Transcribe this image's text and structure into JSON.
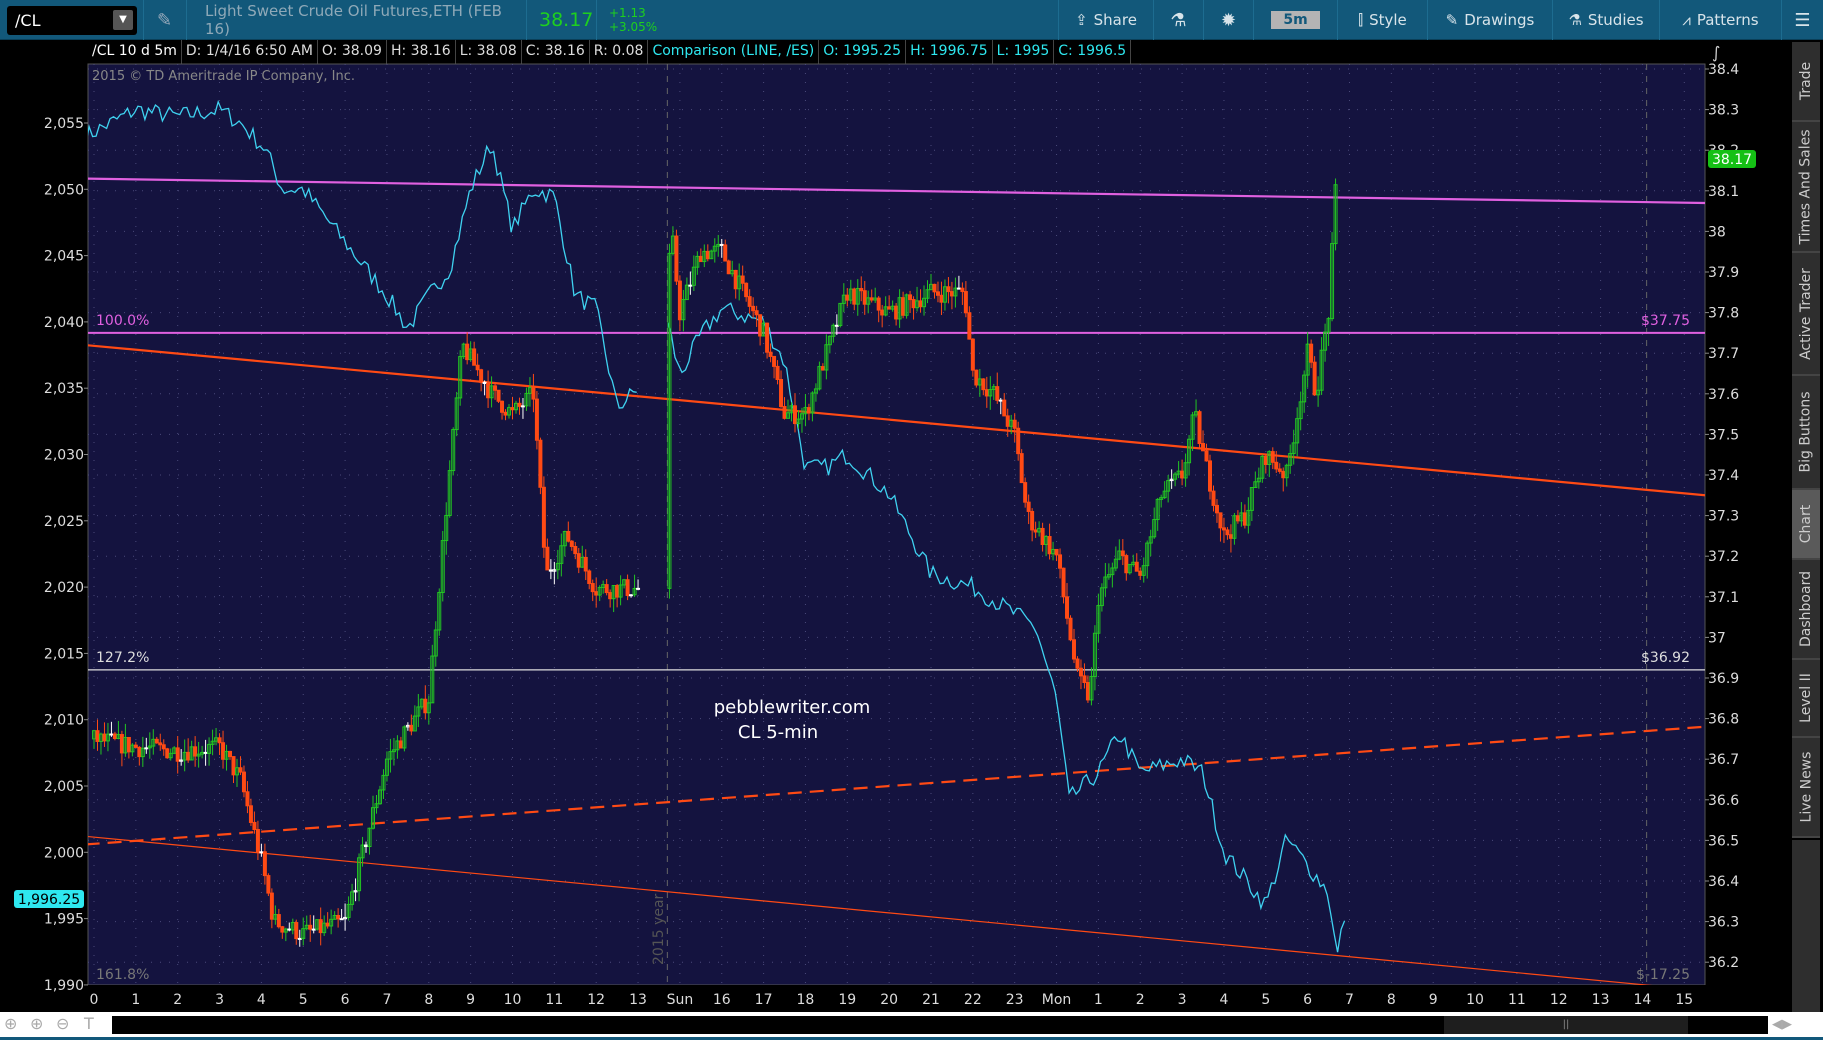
{
  "toolbar": {
    "symbol": "/CL",
    "description": "Light Sweet Crude Oil Futures,ETH (FEB 16)",
    "last": "38.17",
    "change": "+1.13",
    "change_pct": "+3.05%",
    "share": "Share",
    "timeframe": "5m",
    "style": "Style",
    "drawings": "Drawings",
    "studies": "Studies",
    "patterns": "Patterns"
  },
  "infobar": {
    "title": "/CL 10 d 5m",
    "date": "D: 1/4/16 6:50 AM",
    "open": "O: 38.09",
    "high": "H: 38.16",
    "low": "L: 38.08",
    "close": "C: 38.16",
    "range": "R: 0.08",
    "comparison": "Comparison (LINE, /ES)",
    "cmp_open": "O: 1995.25",
    "cmp_high": "H: 1996.75",
    "cmp_low": "L: 1995",
    "cmp_close": "C: 1996.5"
  },
  "copyright": "2015 © TD Ameritrade IP Company, Inc.",
  "watermark": {
    "line1": "pebblewriter.com",
    "line2": "CL 5-min"
  },
  "year_marker": "2015 year",
  "markers": {
    "left": "1,996.25",
    "right": "38.17"
  },
  "sidebar": [
    "Trade",
    "Times And Sales",
    "Active Trader",
    "Big Buttons",
    "Chart",
    "Dashboard",
    "Level II",
    "Live News"
  ],
  "sidebar_active": "Chart",
  "colors": {
    "up": "#22c422",
    "down": "#ff4a14",
    "compare": "#3fd2f0",
    "magenta": "#e060e0",
    "orange": "#ff4a14",
    "plot_bg": "#14133f"
  },
  "chart_data": {
    "type": "candlestick",
    "x_ticks": [
      "0",
      "1",
      "2",
      "3",
      "4",
      "5",
      "6",
      "7",
      "8",
      "9",
      "10",
      "11",
      "12",
      "13",
      "Sun",
      "16",
      "17",
      "18",
      "19",
      "20",
      "21",
      "22",
      "23",
      "Mon",
      "1",
      "2",
      "3",
      "4",
      "5",
      "6",
      "7",
      "8",
      "9",
      "10",
      "11",
      "12",
      "13",
      "14",
      "15"
    ],
    "right_axis": {
      "min": 36.2,
      "max": 38.4,
      "step": 0.1,
      "labels": [
        "38.4",
        "38.3",
        "38.2",
        "38.1",
        "38",
        "37.9",
        "37.8",
        "37.7",
        "37.6",
        "37.5",
        "37.4",
        "37.3",
        "37.2",
        "37.1",
        "37",
        "36.9",
        "36.8",
        "36.7",
        "36.6",
        "36.5",
        "36.4",
        "36.3",
        "36.2"
      ]
    },
    "left_axis": {
      "min": 1990,
      "max": 2055,
      "labels": [
        "2,055",
        "2,050",
        "2,045",
        "2,040",
        "2,035",
        "2,030",
        "2,025",
        "2,020",
        "2,015",
        "2,010",
        "2,005",
        "2,000",
        "1,995",
        "1,990"
      ]
    },
    "cl_path": [
      [
        0,
        36.75
      ],
      [
        1,
        36.73
      ],
      [
        2,
        36.72
      ],
      [
        3,
        36.73
      ],
      [
        3.5,
        36.65
      ],
      [
        4,
        36.45
      ],
      [
        4.3,
        36.3
      ],
      [
        5,
        36.27
      ],
      [
        6,
        36.3
      ],
      [
        6.5,
        36.5
      ],
      [
        7,
        36.7
      ],
      [
        8,
        36.85
      ],
      [
        8.4,
        37.3
      ],
      [
        8.8,
        37.72
      ],
      [
        9.5,
        37.6
      ],
      [
        10,
        37.55
      ],
      [
        10.5,
        37.6
      ],
      [
        10.8,
        37.15
      ],
      [
        11.3,
        37.25
      ],
      [
        12,
        37.12
      ],
      [
        13,
        37.12
      ],
      [
        13.7,
        37.85
      ],
      [
        13.8,
        38.0
      ],
      [
        14,
        37.8
      ],
      [
        14.5,
        37.95
      ],
      [
        15,
        37.95
      ],
      [
        15.5,
        37.85
      ],
      [
        16,
        37.75
      ],
      [
        16.5,
        37.55
      ],
      [
        17,
        37.55
      ],
      [
        17.5,
        37.7
      ],
      [
        18,
        37.85
      ],
      [
        19,
        37.8
      ],
      [
        20,
        37.85
      ],
      [
        20.8,
        37.85
      ],
      [
        21,
        37.65
      ],
      [
        21.5,
        37.6
      ],
      [
        22,
        37.5
      ],
      [
        22.3,
        37.3
      ],
      [
        23,
        37.2
      ],
      [
        23.5,
        36.9
      ],
      [
        23.8,
        36.85
      ],
      [
        24,
        37.1
      ],
      [
        24.5,
        37.2
      ],
      [
        25,
        37.15
      ],
      [
        25.5,
        37.35
      ],
      [
        26,
        37.4
      ],
      [
        26.3,
        37.55
      ],
      [
        26.5,
        37.45
      ],
      [
        27,
        37.25
      ],
      [
        27.5,
        37.3
      ],
      [
        28,
        37.45
      ],
      [
        28.5,
        37.4
      ],
      [
        29,
        37.7
      ],
      [
        29.2,
        37.6
      ],
      [
        29.5,
        37.8
      ],
      [
        29.7,
        38.15
      ]
    ],
    "es_path": [
      [
        -0.2,
        2054
      ],
      [
        1,
        2056
      ],
      [
        2,
        2055.5
      ],
      [
        3,
        2056
      ],
      [
        3.5,
        2055
      ],
      [
        4.1,
        2053
      ],
      [
        4.5,
        2050
      ],
      [
        5,
        2050
      ],
      [
        6,
        2046
      ],
      [
        7,
        2042
      ],
      [
        7.5,
        2039.5
      ],
      [
        8,
        2042
      ],
      [
        8.5,
        2044
      ],
      [
        9,
        2050
      ],
      [
        9.5,
        2053.5
      ],
      [
        10,
        2047
      ],
      [
        10.5,
        2050
      ],
      [
        11,
        2049.5
      ],
      [
        11.5,
        2042
      ],
      [
        12,
        2041
      ],
      [
        12.5,
        2033.5
      ],
      [
        13,
        2035
      ],
      [
        13.7,
        2040
      ],
      [
        14,
        2036
      ],
      [
        14.5,
        2039
      ],
      [
        15,
        2041
      ],
      [
        16,
        2040
      ],
      [
        16.5,
        2037
      ],
      [
        17,
        2029
      ],
      [
        17.5,
        2029
      ],
      [
        18,
        2030
      ],
      [
        19,
        2027
      ],
      [
        19.5,
        2024
      ],
      [
        20,
        2021
      ],
      [
        21,
        2020
      ],
      [
        22,
        2018
      ],
      [
        22.5,
        2017
      ],
      [
        23,
        2011.5
      ],
      [
        23.3,
        2004
      ],
      [
        24,
        2006
      ],
      [
        24.5,
        2009
      ],
      [
        25,
        2006
      ],
      [
        26,
        2007
      ],
      [
        26.5,
        2006
      ],
      [
        27,
        2000
      ],
      [
        27.5,
        1998
      ],
      [
        28,
        1996
      ],
      [
        28.5,
        2001
      ],
      [
        29,
        1999
      ],
      [
        29.5,
        1997
      ],
      [
        29.7,
        1992
      ],
      [
        29.9,
        1995.5
      ]
    ],
    "es_gap": [
      13.0,
      13.7
    ],
    "drawings": [
      {
        "name": "magenta-trendline",
        "from": [
          -0.2,
          38.13
        ],
        "to": [
          38.5,
          38.07
        ],
        "color": "#e060e0",
        "dash": false
      },
      {
        "name": "orange-trendline-upper",
        "from": [
          -0.2,
          37.72
        ],
        "to": [
          38.5,
          37.35
        ],
        "color": "#ff4a14",
        "dash": false
      },
      {
        "name": "orange-dashed-trendline",
        "from": [
          -0.2,
          36.49
        ],
        "to": [
          38.5,
          36.78
        ],
        "color": "#ff4a14",
        "dash": true
      },
      {
        "name": "orange-trendline-lower",
        "from": [
          -0.2,
          36.51
        ],
        "to": [
          38.5,
          36.13
        ],
        "color": "#ff4a14",
        "dash": false,
        "thin": true
      }
    ],
    "fib_levels": [
      {
        "pct": "100.0%",
        "price": 37.75,
        "label": "$37.75",
        "color": "#e060e0"
      },
      {
        "pct": "127.2%",
        "price": 36.92,
        "label": "$36.92",
        "color": "#dddddd"
      },
      {
        "pct": "161.8%",
        "price": null,
        "label": "$-17.25",
        "color": "#777777"
      }
    ]
  }
}
